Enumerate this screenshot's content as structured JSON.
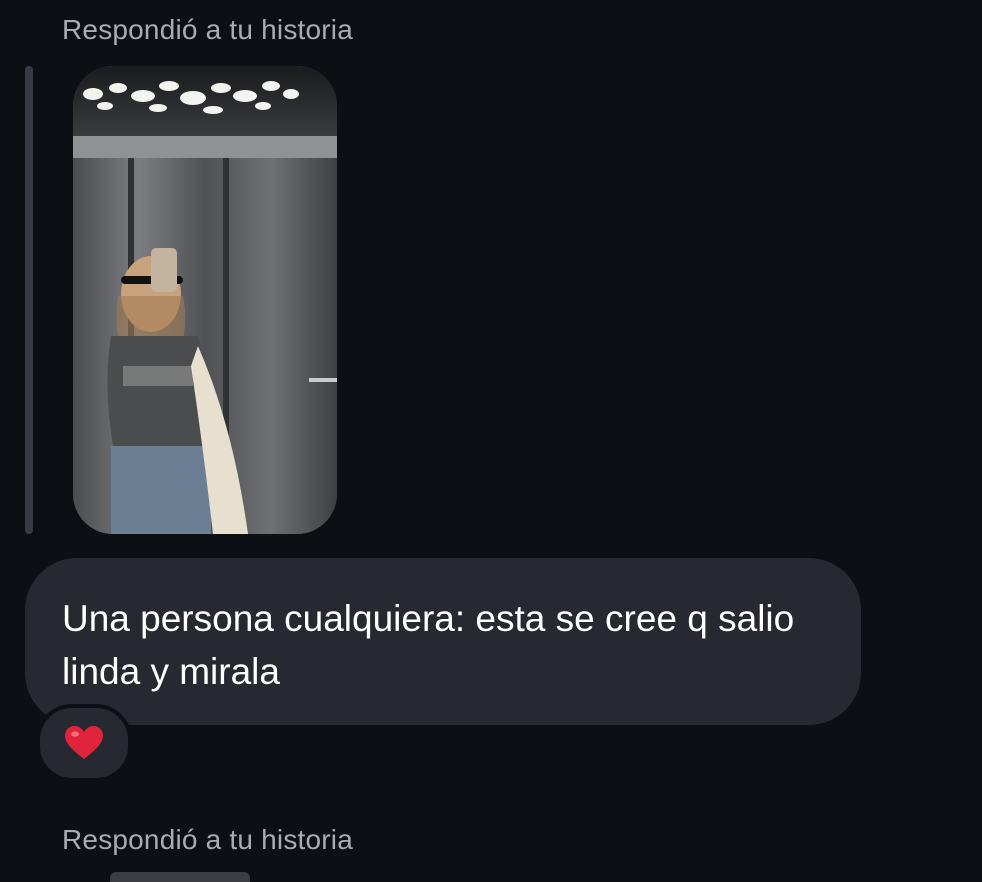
{
  "messages": [
    {
      "reply_label": "Respondió a tu historia",
      "story_image": "mirror-selfie-elevator",
      "text": "Una persona cualquiera: esta se cree q salio linda y mirala",
      "reaction": "heart-icon"
    },
    {
      "reply_label": "Respondió a tu historia"
    }
  ],
  "colors": {
    "background": "#0c1014",
    "bubble": "#262a30",
    "label": "#a8acb3",
    "quote_bar": "#363b43",
    "heart": "#e0243b"
  }
}
